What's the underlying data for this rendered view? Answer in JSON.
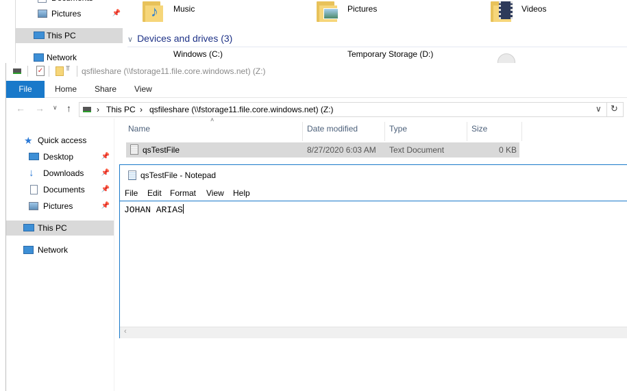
{
  "background_window": {
    "sidebar": {
      "items": [
        {
          "label": "Documents",
          "icon": "documents-icon"
        },
        {
          "label": "Pictures",
          "icon": "pictures-icon"
        },
        {
          "label": "This PC",
          "icon": "computer-icon"
        },
        {
          "label": "Network",
          "icon": "network-icon"
        }
      ]
    },
    "folders": [
      {
        "label": "Music",
        "icon": "music-folder-icon"
      },
      {
        "label": "Pictures",
        "icon": "pictures-folder-icon"
      },
      {
        "label": "Videos",
        "icon": "videos-folder-icon"
      }
    ],
    "devices_header": "Devices and drives (3)",
    "drives": [
      {
        "label": "Windows (C:)"
      },
      {
        "label": "Temporary Storage (D:)"
      }
    ]
  },
  "explorer": {
    "title": "qsfileshare (\\\\fstorage11.file.core.windows.net) (Z:)",
    "ribbon_tabs": [
      "File",
      "Home",
      "Share",
      "View"
    ],
    "breadcrumb": [
      "This PC",
      "qsfileshare (\\\\fstorage11.file.core.windows.net) (Z:)"
    ],
    "sidebar": {
      "quick_access": "Quick access",
      "items": [
        {
          "label": "Desktop",
          "pinned": true
        },
        {
          "label": "Downloads",
          "pinned": true
        },
        {
          "label": "Documents",
          "pinned": true
        },
        {
          "label": "Pictures",
          "pinned": true
        }
      ],
      "this_pc": "This PC",
      "network": "Network"
    },
    "columns": [
      "Name",
      "Date modified",
      "Type",
      "Size"
    ],
    "files": [
      {
        "name": "qsTestFile",
        "date_modified": "8/27/2020 6:03 AM",
        "type": "Text Document",
        "size": "0 KB"
      }
    ]
  },
  "notepad": {
    "title": "qsTestFile - Notepad",
    "menus": [
      "File",
      "Edit",
      "Format",
      "View",
      "Help"
    ],
    "content": "JOHAN ARIAS"
  },
  "colors": {
    "accent": "#1979ca",
    "selection": "#d9d9d9",
    "folder_yellow": "#f6d67a",
    "header_text": "#4c607a"
  }
}
